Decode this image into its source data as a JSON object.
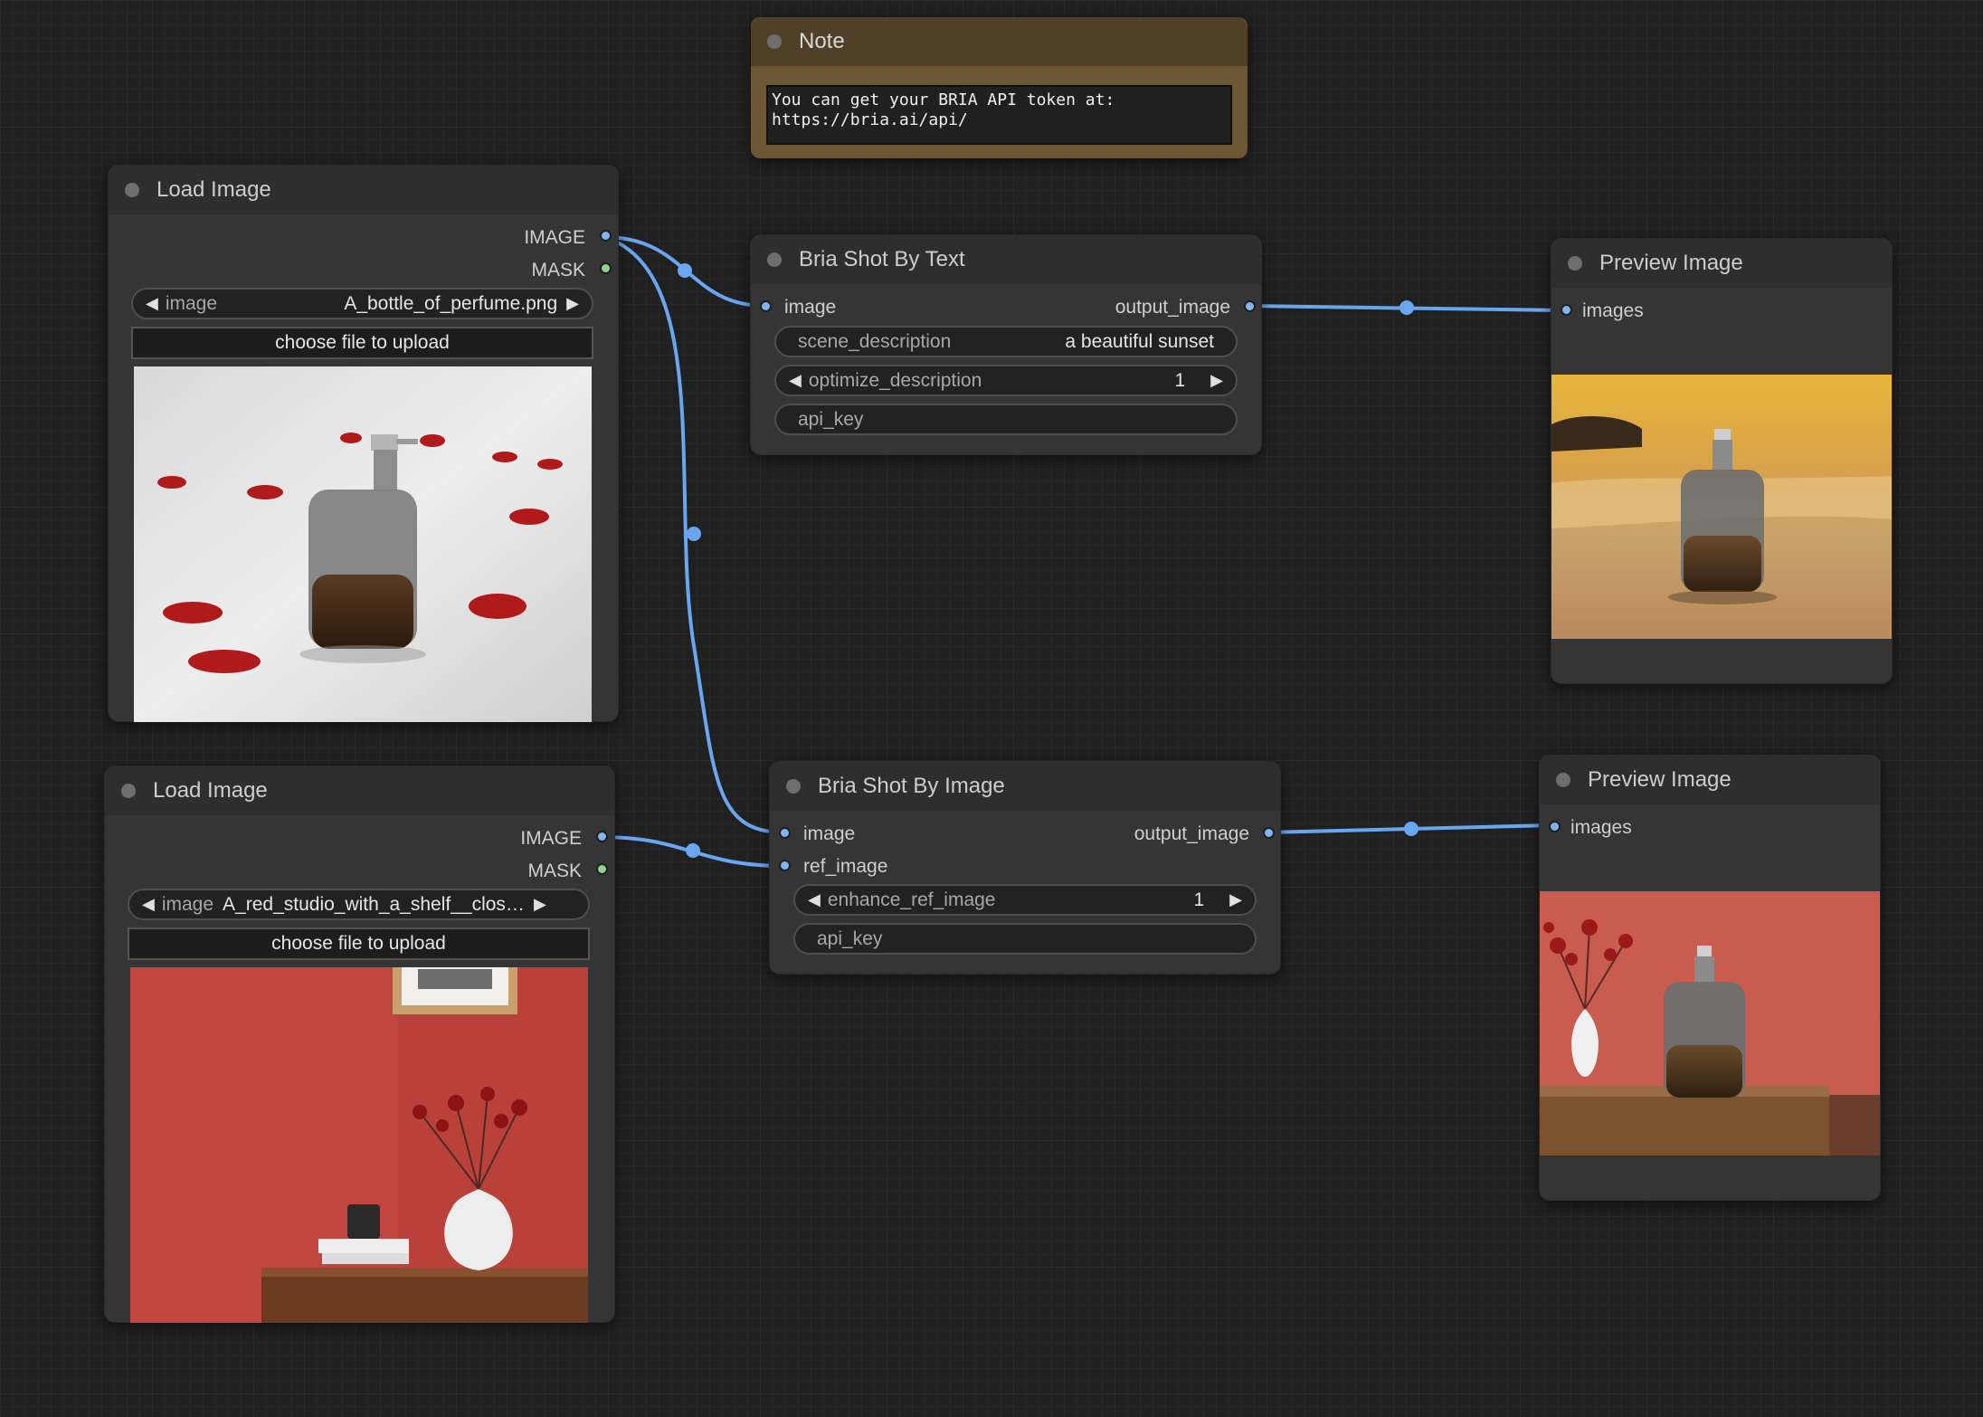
{
  "colors": {
    "wire": "#6aa6f0",
    "image_port": "#7fb4f0",
    "mask_port": "#8fd48f",
    "note_bg": "#6b5734"
  },
  "note": {
    "title": "Note",
    "line1": "You can get your BRIA API token at:",
    "line2": "https://bria.ai/api/"
  },
  "load_image_1": {
    "title": "Load Image",
    "out_image": "IMAGE",
    "out_mask": "MASK",
    "image_widget_name": "image",
    "image_widget_value": "A_bottle_of_perfume.png",
    "upload_label": "choose file to upload",
    "preview_desc": "perfume-bottle-on-white-sheet-with-rose-petals"
  },
  "load_image_2": {
    "title": "Load Image",
    "out_image": "IMAGE",
    "out_mask": "MASK",
    "image_widget_name": "image",
    "image_widget_value": "A_red_studio_with_a_shelf__clos…",
    "upload_label": "choose file to upload",
    "preview_desc": "red-wall-studio-with-vase-and-shelf"
  },
  "bria_text": {
    "title": "Bria Shot By Text",
    "in_image": "image",
    "out_image": "output_image",
    "scene_label": "scene_description",
    "scene_value": "a beautiful sunset",
    "optimize_label": "optimize_description",
    "optimize_value": "1",
    "api_key_label": "api_key"
  },
  "bria_image": {
    "title": "Bria Shot By Image",
    "in_image": "image",
    "in_ref": "ref_image",
    "out_image": "output_image",
    "enhance_label": "enhance_ref_image",
    "enhance_value": "1",
    "api_key_label": "api_key"
  },
  "preview_1": {
    "title": "Preview Image",
    "in_images": "images",
    "preview_desc": "perfume-bottle-on-beach-at-sunset"
  },
  "preview_2": {
    "title": "Preview Image",
    "in_images": "images",
    "preview_desc": "perfume-bottle-on-shelf-against-red-wall"
  }
}
